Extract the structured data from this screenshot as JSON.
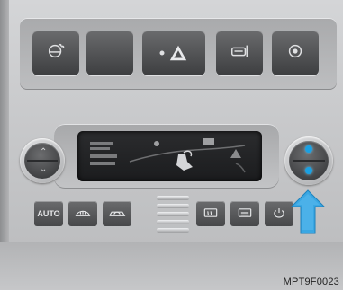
{
  "top_buttons": [
    {
      "icon": "steering-wheel-heater-icon"
    },
    {
      "icon": "blank-icon"
    },
    {
      "icon": "hazard-warning-icon"
    },
    {
      "icon": "seat-heater-icon"
    },
    {
      "icon": "settings-dial-icon"
    }
  ],
  "bottom_buttons": {
    "auto_label": "AUTO",
    "buttons": [
      {
        "icon": "front-defroster-icon"
      },
      {
        "icon": "recirculation-icon"
      },
      {
        "icon": "rear-defroster-icon"
      },
      {
        "icon": "fan-mode-icon"
      },
      {
        "icon": "power-icon"
      }
    ]
  },
  "caption": "MPT9F0023",
  "colors": {
    "indicator": "#1aa0e2",
    "arrow": "#3aa7e3",
    "screen": "#1f2022"
  }
}
